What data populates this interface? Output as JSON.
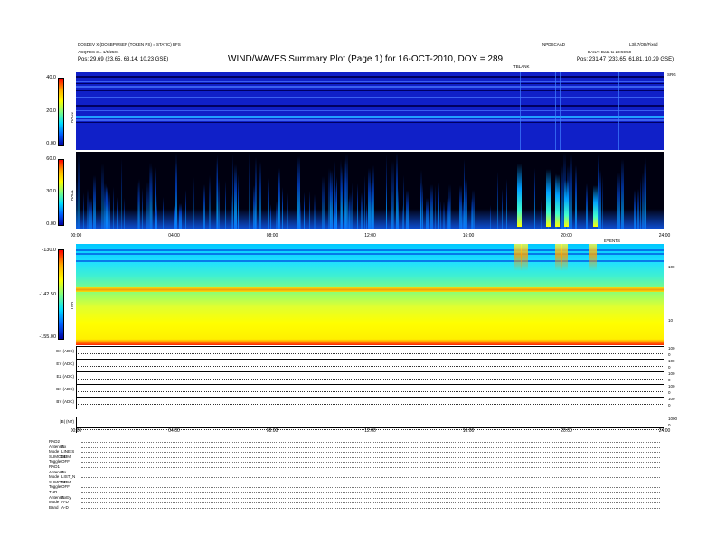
{
  "header": {
    "title": "WIND/WAVES Summary Plot (Page 1) for 16-OCT-2010, DOY = 289",
    "left_line1": "DOSDEV X (DOSBPWSEP (TOKEN PS) = STATIC) BFS",
    "left_line2": "ACQRES 3 = 1/5/2501",
    "left_pos": "Pos:  29.69 (23.65, 63.14, 10.23 GSE)",
    "right_id": "NPDSCAAD",
    "right_dir": "L3/L7/OD/Fixed",
    "right_daily": "DAILY: Data to 23:59:59",
    "right_pos": "Pos:  231.47 (233.65, 61.81, 10.29 GSE)",
    "top_center_label": "TBLANK",
    "top_right_label": "SRG",
    "tnr_corner_label": "EVENTS"
  },
  "panels": {
    "rad2": {
      "name": "RAD2",
      "colorbar_ticks": [
        "40.0",
        "20.0",
        "0.00"
      ]
    },
    "rad1": {
      "name": "RAD1",
      "colorbar_ticks": [
        "60.0",
        "30.0",
        "0.00"
      ]
    },
    "tnr": {
      "name": "TNR",
      "colorbar_ticks": [
        "-130.0",
        "-142.50",
        "-155.00"
      ],
      "right_axis": [
        "100",
        "10"
      ]
    },
    "time_ticks_a": [
      "00:00",
      "04:00",
      "08:00",
      "12:00",
      "16:00",
      "20:00",
      "24:00"
    ],
    "time_ticks_b": [
      "00:00",
      "04:00",
      "08:00",
      "12:00",
      "16:00",
      "20:00",
      "24:00"
    ]
  },
  "strips": [
    {
      "label": "EX (ADC)",
      "right": [
        "100",
        "0"
      ]
    },
    {
      "label": "EY (ADC)",
      "right": [
        "100",
        "0"
      ]
    },
    {
      "label": "EZ (ADC)",
      "right": [
        "100",
        "0"
      ]
    },
    {
      "label": "BX (ADC)",
      "right": [
        "100",
        "0"
      ]
    },
    {
      "label": "BY (ADC)",
      "right": [
        "100",
        "0"
      ]
    },
    {
      "label": "|B| (NT)",
      "right": [
        "1000",
        "0"
      ]
    }
  ],
  "instrument_table": [
    [
      "RAD2"
    ],
    [
      "Antenna",
      "Ex"
    ],
    [
      "Mode",
      "LINE S"
    ],
    [
      "SUMODE",
      "SUM"
    ],
    [
      "Toggle",
      "OFF"
    ],
    [
      "RAD1"
    ],
    [
      "Antenna",
      "Ex"
    ],
    [
      "Mode",
      "LIST_N"
    ],
    [
      "SUMODE",
      "SUM"
    ],
    [
      "Toggle",
      "OFF"
    ],
    [
      "TNR"
    ],
    [
      "Antenna",
      "ExEy"
    ],
    [
      "Mode",
      "A-D"
    ],
    [
      "Band",
      "A-D"
    ]
  ],
  "chart_data": {
    "type": "heatmap",
    "title": "WIND/WAVES Summary Plot (Page 1) for 16-OCT-2010, DOY = 289",
    "x_range_hours": [
      0,
      24
    ],
    "x_ticks": [
      "00:00",
      "04:00",
      "08:00",
      "12:00",
      "16:00",
      "20:00",
      "24:00"
    ],
    "panels": [
      {
        "name": "RAD2",
        "colorbar_range": [
          0,
          40
        ]
      },
      {
        "name": "RAD1",
        "colorbar_range": [
          0,
          60
        ]
      },
      {
        "name": "TNR",
        "colorbar_range": [
          -155,
          -130
        ]
      }
    ],
    "colors": {
      "low": "#0000aa",
      "mid": "#00e0ff",
      "high": "#ffff00",
      "peak": "#ff0000"
    }
  }
}
